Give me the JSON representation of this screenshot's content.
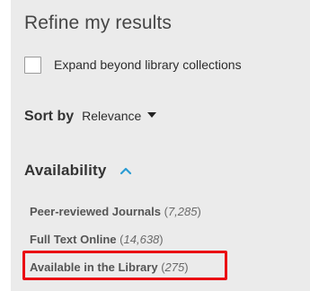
{
  "panel": {
    "title": "Refine my results",
    "expand": {
      "label": "Expand beyond library collections",
      "checked": false
    },
    "sort": {
      "label": "Sort by",
      "selected": "Relevance"
    },
    "availability": {
      "heading": "Availability",
      "items": [
        {
          "label": "Peer-reviewed Journals",
          "count": "7,285"
        },
        {
          "label": "Full Text Online",
          "count": "14,638"
        },
        {
          "label": "Available in the Library",
          "count": "275"
        }
      ]
    }
  },
  "colors": {
    "panel_background": "#ebebeb",
    "accent_chevron": "#2b9bd3",
    "highlight_border": "#ea0b13"
  },
  "icons": {
    "sort_caret": "caret-down-icon",
    "availability_toggle": "chevron-up-icon"
  }
}
